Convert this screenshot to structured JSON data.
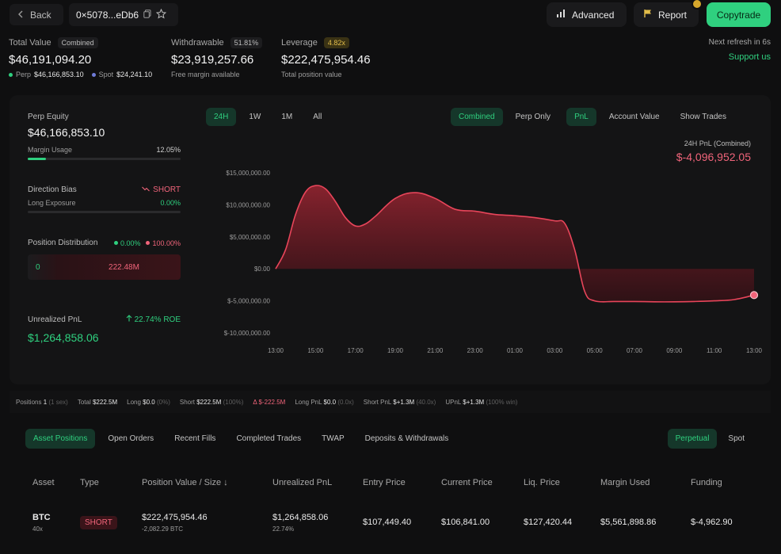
{
  "topbar": {
    "back_label": "Back",
    "address": "0×5078...eDb6",
    "advanced_label": "Advanced",
    "report_label": "Report",
    "copytrade_label": "Copytrade"
  },
  "summary": {
    "total_value": {
      "label": "Total Value",
      "tag": "Combined",
      "value": "$46,191,094.20",
      "perp_label": "Perp",
      "perp_value": "$46,166,853.10",
      "spot_label": "Spot",
      "spot_value": "$24,241.10"
    },
    "withdrawable": {
      "label": "Withdrawable",
      "tag": "51.81%",
      "value": "$23,919,257.66",
      "sub": "Free margin available"
    },
    "leverage": {
      "label": "Leverage",
      "tag": "4.82x",
      "value": "$222,475,954.46",
      "sub": "Total position value"
    },
    "refresh": "Next refresh in 6s",
    "support": "Support us"
  },
  "left_panel": {
    "perp_equity_label": "Perp Equity",
    "perp_equity_value": "$46,166,853.10",
    "margin_usage_label": "Margin Usage",
    "margin_usage_value": "12.05%",
    "margin_usage_fraction": 0.1205,
    "direction_bias_label": "Direction Bias",
    "direction_bias_value": "SHORT",
    "long_exposure_label": "Long Exposure",
    "long_exposure_value": "0.00%",
    "position_dist_label": "Position Distribution",
    "dist_long": "0.00%",
    "dist_short": "100.00%",
    "dist_left_value": "0",
    "dist_right_value": "222.48M",
    "upnl_label": "Unrealized PnL",
    "upnl_roe": "22.74% ROE",
    "upnl_value": "$1,264,858.06"
  },
  "chart_tabs": {
    "ranges": [
      "24H",
      "1W",
      "1M",
      "All"
    ],
    "active_range": "24H",
    "modes": [
      "Combined",
      "Perp Only"
    ],
    "active_mode": "Combined",
    "metrics": [
      "PnL",
      "Account Value"
    ],
    "active_metric": "PnL",
    "show_trades": "Show Trades"
  },
  "pnl_header": {
    "label": "24H PnL (Combined)",
    "value": "$-4,096,952.05"
  },
  "colors": {
    "accent_green": "#2fd07f",
    "loss_red": "#f0647a",
    "line_red": "#e8455a"
  },
  "chart_data": {
    "type": "area",
    "title": "",
    "xlabel": "",
    "ylabel": "",
    "x_ticks": [
      "13:00",
      "15:00",
      "17:00",
      "19:00",
      "21:00",
      "23:00",
      "01:00",
      "03:00",
      "05:00",
      "07:00",
      "09:00",
      "11:00",
      "13:00"
    ],
    "y_ticks": [
      "$15,000,000.00",
      "$10,000,000.00",
      "$5,000,000.00",
      "$0.00",
      "$-5,000,000.00",
      "$-10,000,000.00"
    ],
    "y_tick_values": [
      15000000,
      10000000,
      5000000,
      0,
      -5000000,
      -10000000
    ],
    "ylim": [
      -10000000,
      15000000
    ],
    "grid": false,
    "series": [
      {
        "x": [
          0,
          0.5,
          1,
          1.5,
          2,
          2.5,
          3,
          3.5,
          4,
          4.5,
          5,
          6,
          7,
          8,
          9,
          10,
          11,
          12,
          13,
          14,
          14.5,
          15,
          15.5,
          16,
          17,
          18,
          19,
          20,
          21,
          22,
          23,
          24
        ],
        "values": [
          0,
          3000000,
          8500000,
          12000000,
          13000000,
          12500000,
          10500000,
          8000000,
          6700000,
          7000000,
          8200000,
          11000000,
          11900000,
          11000000,
          9300000,
          9000000,
          8500000,
          8300000,
          8000000,
          7500000,
          7100000,
          3000000,
          -3500000,
          -5000000,
          -5100000,
          -5100000,
          -5150000,
          -5150000,
          -5100000,
          -5000000,
          -4800000,
          -4100000
        ]
      }
    ]
  },
  "stats_strip": {
    "positions_label": "Positions",
    "positions_value": "1",
    "positions_sub": "(1 sex)",
    "total_label": "Total",
    "total_value": "$222.5M",
    "long_label": "Long",
    "long_value": "$0.0",
    "long_sub": "(0%)",
    "short_label": "Short",
    "short_value": "$222.5M",
    "short_sub": "(100%)",
    "delta_value": "Δ $-222.5M",
    "long_pnl_label": "Long PnL",
    "long_pnl_value": "$0.0",
    "long_pnl_sub": "(0.0x)",
    "short_pnl_label": "Short PnL",
    "short_pnl_value": "$+1.3M",
    "short_pnl_sub": "(40.0x)",
    "upnl_label": "UPnL",
    "upnl_value": "$+1.3M",
    "upnl_sub": "(100% win)"
  },
  "bottom_tabs": {
    "items": [
      "Asset Positions",
      "Open Orders",
      "Recent Fills",
      "Completed Trades",
      "TWAP",
      "Deposits & Withdrawals"
    ],
    "active": "Asset Positions",
    "market_items": [
      "Perpetual",
      "Spot"
    ],
    "market_active": "Perpetual"
  },
  "table": {
    "headers": [
      "Asset",
      "Type",
      "Position Value / Size ↓",
      "Unrealized PnL",
      "Entry Price",
      "Current Price",
      "Liq. Price",
      "Margin Used",
      "Funding"
    ],
    "rows": [
      {
        "asset": "BTC",
        "leverage": "40x",
        "type": "SHORT",
        "position_value": "$222,475,954.46",
        "size": "-2,082.29 BTC",
        "upnl": "$1,264,858.06",
        "upnl_pct": "22.74%",
        "entry_price": "$107,449.40",
        "current_price": "$106,841.00",
        "liq_price": "$127,420.44",
        "margin_used": "$5,561,898.86",
        "funding": "$-4,962.90"
      }
    ]
  }
}
